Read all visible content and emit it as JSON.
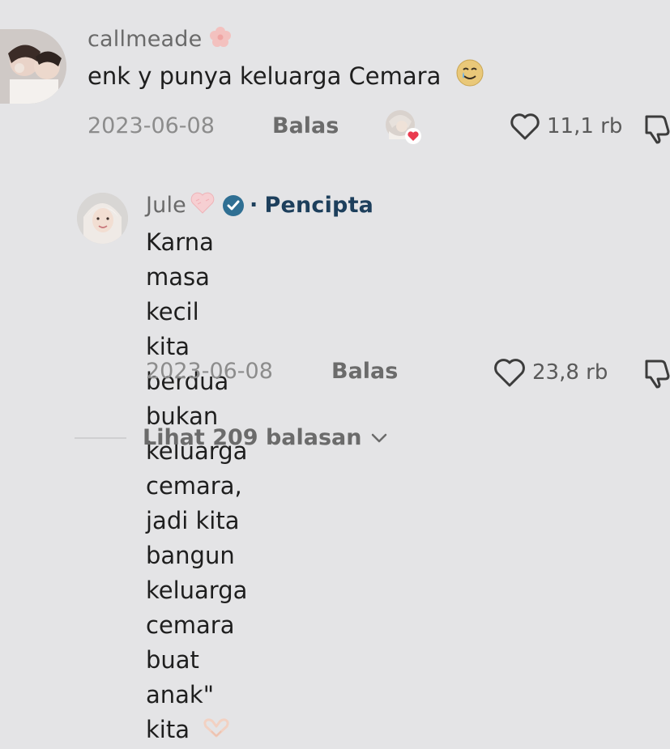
{
  "comments": [
    {
      "username": "callmeade",
      "username_emoji": "flower-emoji",
      "text": "enk y punya keluarga Cemara",
      "text_emoji": "crying-smile-emoji",
      "date": "2023-06-08",
      "reply_label": "Balas",
      "likes": "11,1 rb",
      "creator_liked": true
    }
  ],
  "reply": {
    "username": "Jule",
    "username_emoji": "pink-heart-emoji",
    "verified": true,
    "separator": "·",
    "creator_label": "Pencipta",
    "text_lines": [
      "Karna masa kecil kita berdua bukan",
      "keluarga cemara, jadi kita bangun",
      "keluarga cemara buat anak\" kita"
    ],
    "text_emoji": "heart-hands-emoji",
    "date": "2023-06-08",
    "reply_label": "Balas",
    "likes": "23,8 rb"
  },
  "view_replies": {
    "label": "Lihat 209 balasan"
  },
  "colors": {
    "background": "#e4e4e6",
    "creator_label": "#1d3f5c",
    "verified_badge": "#2f6f93",
    "like_heart_red": "#ea3b4f"
  }
}
